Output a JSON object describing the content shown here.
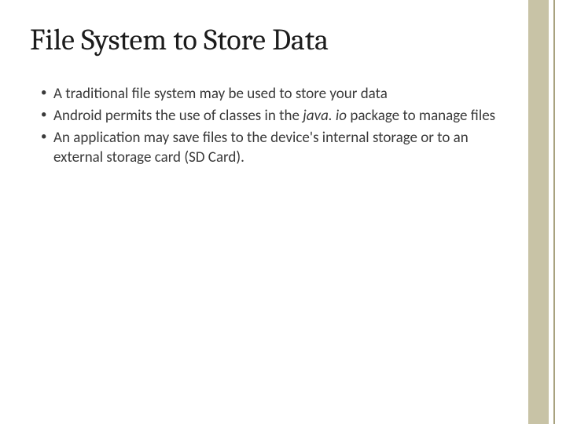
{
  "slide": {
    "title": "File System to Store Data",
    "bullets": [
      {
        "pre": "A traditional file system may be used to store your data",
        "em": "",
        "post": ""
      },
      {
        "pre": "Android permits the use of classes in the ",
        "em": "java. io",
        "post": " package to manage files"
      },
      {
        "pre": "An application may save files to the device's internal storage or to an external storage card (SD Card).",
        "em": "",
        "post": ""
      }
    ]
  },
  "colors": {
    "accent": "#c8c3a6",
    "accent_dark": "#a8a27f"
  }
}
